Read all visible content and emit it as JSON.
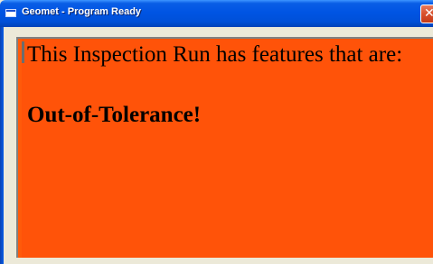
{
  "window": {
    "title": "Geomet - Program Ready",
    "close_glyph": "✕",
    "titlebar_color": "#0054e3",
    "frame_color": "#ece9d8"
  },
  "message": {
    "line1": "This Inspection Run has features that are:",
    "line2": "Out-of-Tolerance!",
    "background_color": "#ff5309",
    "text_color": "#000000"
  },
  "icons": {
    "app": "window-icon",
    "close": "close-icon"
  }
}
